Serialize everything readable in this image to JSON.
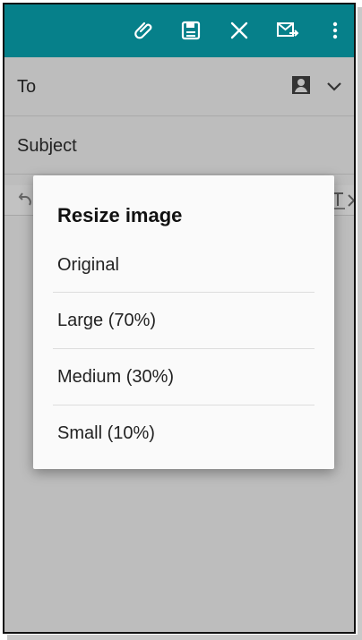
{
  "email": {
    "to_label": "To",
    "subject_label": "Subject"
  },
  "toolbar": {
    "icons": [
      "paperclip-icon",
      "save-icon",
      "close-icon",
      "send-icon",
      "more-vertical-icon"
    ]
  },
  "dialog": {
    "title": "Resize image",
    "options": [
      {
        "label": "Original"
      },
      {
        "label": "Large (70%)"
      },
      {
        "label": "Medium (30%)"
      },
      {
        "label": "Small (10%)"
      }
    ]
  },
  "colors": {
    "topbar": "#06808a",
    "scrim": "#bdbdbd",
    "dialog_bg": "#fafafa"
  }
}
